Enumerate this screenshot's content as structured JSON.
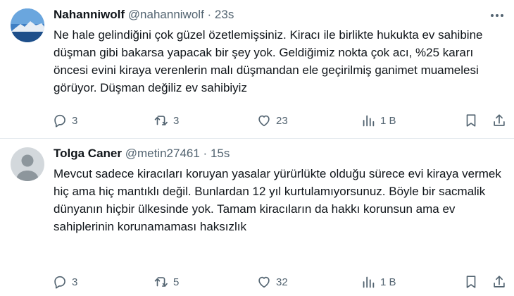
{
  "tweets": [
    {
      "name": "Nahanniwolf",
      "handle": "@nahanniwolf",
      "separator": " · ",
      "time": "23s",
      "text": "Ne hale gelindiğini çok güzel özetlemişsiniz. Kiracı ile birlikte hukukta ev sahibine düşman gibi bakarsa yapacak bir şey yok. Geldiğimiz nokta çok acı,  %25 kararı öncesi evini kiraya verenlerin malı düşmandan ele geçirilmiş ganimet muamelesi görüyor. Düşman değiliz ev sahibiyiz",
      "replies": "3",
      "retweets": "3",
      "likes": "23",
      "views": "1 B"
    },
    {
      "name": "Tolga Caner",
      "handle": "@metin27461",
      "separator": " · ",
      "time": "15s",
      "text": "Mevcut sadece kiracıları koruyan yasalar yürürlükte olduğu sürece evi kiraya vermek hiç ama hiç mantıklı değil. Bunlardan 12 yıl kurtulamıyorsunuz. Böyle bir sacmalik dünyanın hiçbir ülkesinde yok. Tamam kiracıların da hakkı korunsun ama ev sahiplerinin korunamaması haksızlık",
      "replies": "3",
      "retweets": "5",
      "likes": "32",
      "views": "1 B"
    }
  ],
  "icons": {
    "reply": "reply-icon",
    "retweet": "retweet-icon",
    "like": "heart-icon",
    "views": "views-chart-icon",
    "bookmark": "bookmark-icon",
    "share": "share-icon",
    "more": "more-dots-icon"
  },
  "colors": {
    "text": "#0f1419",
    "secondary": "#536471",
    "divider": "#e6ecf0"
  }
}
